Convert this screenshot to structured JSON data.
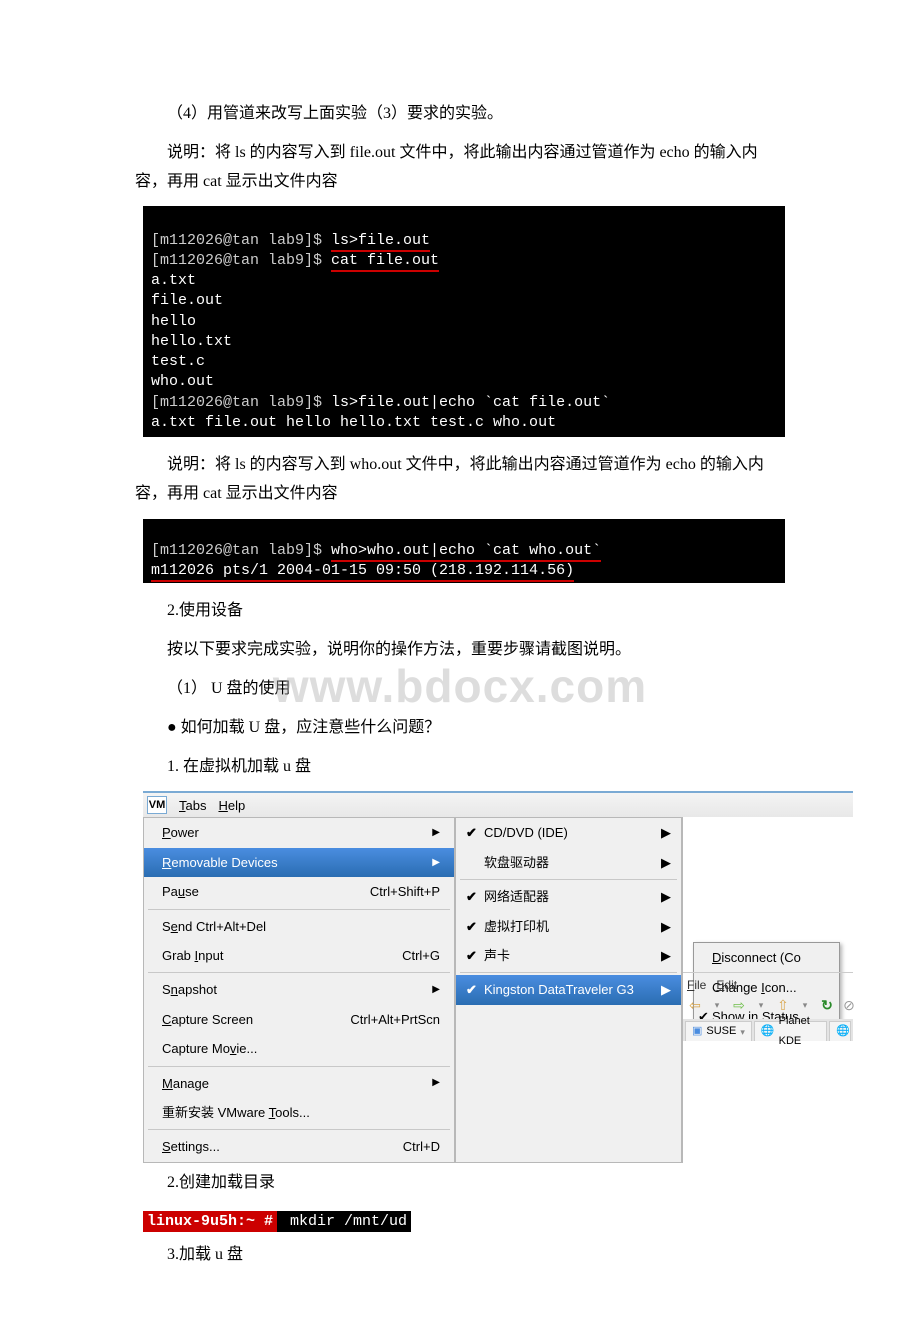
{
  "body": {
    "p1": "（4）用管道来改写上面实验（3）要求的实验。",
    "p2": "说明：将 ls 的内容写入到 file.out 文件中，将此输出内容通过管道作为 echo 的输入内容，再用 cat 显示出文件内容",
    "p3": "说明：将 ls 的内容写入到 who.out 文件中，将此输出内容通过管道作为 echo 的输入内容，再用 cat 显示出文件内容",
    "h2a": "2.使用设备",
    "p4": "按以下要求完成实验，说明你的操作方法，重要步骤请截图说明。",
    "p5": "（1） U 盘的使用",
    "p6": "● 如何加载 U 盘，应注意些什么问题？",
    "p7": "1. 在虚拟机加载 u 盘",
    "p8": "2.创建加载目录",
    "p9": "3.加载 u 盘"
  },
  "terminal1": {
    "l1_prompt": "[m112026@tan lab9]$ ",
    "l1_cmd": "ls>file.out",
    "l2_prompt": "[m112026@tan lab9]$ ",
    "l2_cmd": "cat file.out",
    "l3": "a.txt",
    "l4": "file.out",
    "l5": "hello",
    "l6": "hello.txt",
    "l7": "test.c",
    "l8": "who.out",
    "l9_prompt": "[m112026@tan lab9]$ ",
    "l9_cmd": "ls>file.out|echo `cat file.out`",
    "l10": "a.txt file.out hello hello.txt test.c who.out"
  },
  "terminal2": {
    "l1_prompt": "[m112026@tan lab9]$ ",
    "l1_cmd": "who>who.out|echo `cat who.out`",
    "l2": "m112026 pts/1 2004-01-15 09:50 (218.192.114.56)"
  },
  "vm": {
    "logo": "VM",
    "menu_tabs": "Tabs",
    "menu_tabs_ul": "T",
    "menu_help": "Help",
    "menu_help_ul": "H",
    "left": {
      "power": "Power",
      "removable": "Removable Devices",
      "pause": "Pause",
      "pause_sc": "Ctrl+Shift+P",
      "send": "Send Ctrl+Alt+Del",
      "grab": "Grab Input",
      "grab_sc": "Ctrl+G",
      "snapshot": "Snapshot",
      "capture_screen": "Capture Screen",
      "capture_screen_sc": "Ctrl+Alt+PrtScn",
      "capture_movie": "Capture Movie...",
      "manage": "Manage",
      "reinstall": "重新安装 VMware Tools...",
      "settings": "Settings...",
      "settings_sc": "Ctrl+D"
    },
    "mid": {
      "cddvd": "CD/DVD (IDE)",
      "floppy": "软盘驱动器",
      "network": "网络适配器",
      "printer": "虚拟打印机",
      "sound": "声卡",
      "kingston": "Kingston DataTraveler G3"
    },
    "context": {
      "disconnect": "Disconnect  (Co",
      "changeicon": "Change Icon...",
      "showstatus": "Show in Status"
    },
    "right": {
      "file": "File",
      "edit": "Edit",
      "suse": "SUSE",
      "planet": "Planet KDE"
    }
  },
  "terminal3": {
    "prefix": "linux-9u5h:~ #",
    "cmd": " mkdir /mnt/ud"
  },
  "watermark": "www.bdocx.com"
}
